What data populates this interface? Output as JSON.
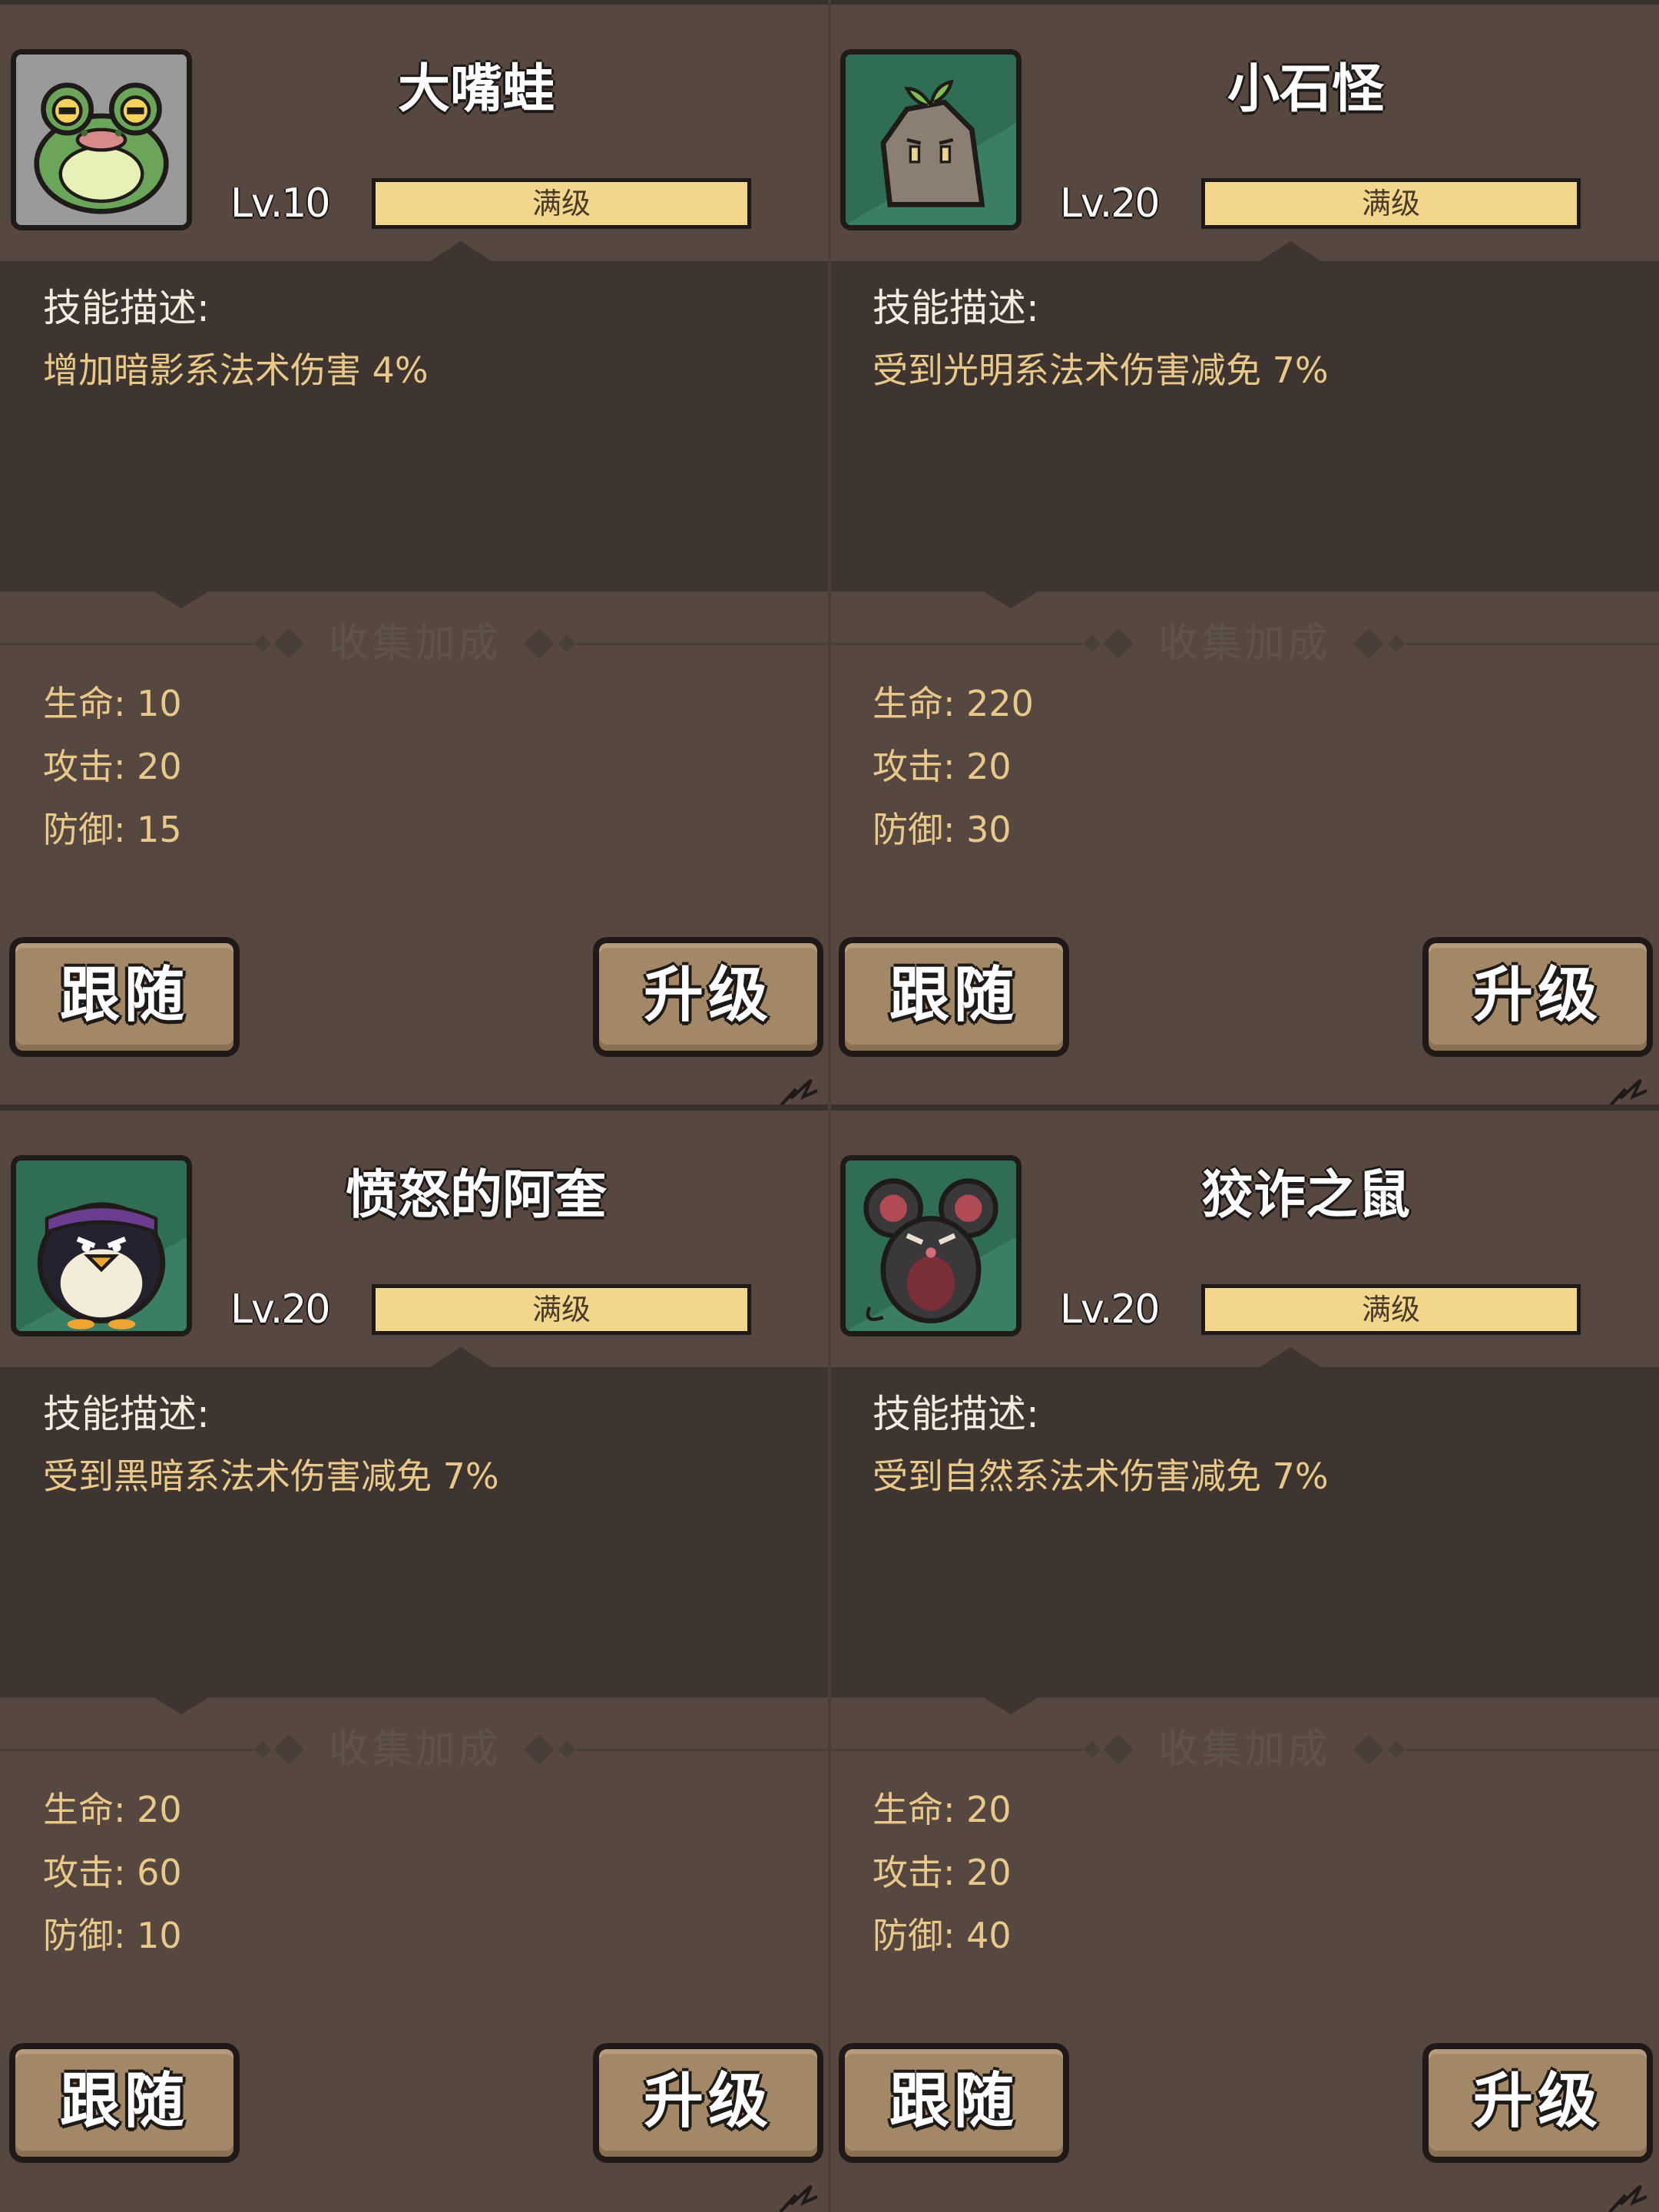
{
  "pets": [
    {
      "name": "大嘴蛙",
      "level": "Lv.10",
      "level_status": "满级",
      "level_progress": 1.0,
      "desc_label": "技能描述:",
      "desc_text": "增加暗影系法术伤害 4%",
      "bonus_title": "收集加成",
      "stats": [
        "生命: 10",
        "攻击: 20",
        "防御: 15"
      ],
      "follow_label": "跟随",
      "upgrade_label": "升级",
      "portrait_bg": "#9a9a9a",
      "portrait_icon": "frog-icon"
    },
    {
      "name": "小石怪",
      "level": "Lv.20",
      "level_status": "满级",
      "level_progress": 1.0,
      "desc_label": "技能描述:",
      "desc_text": "受到光明系法术伤害减免 7%",
      "bonus_title": "收集加成",
      "stats": [
        "生命: 220",
        "攻击: 20",
        "防御: 30"
      ],
      "follow_label": "跟随",
      "upgrade_label": "升级",
      "portrait_bg": "#2f6e55",
      "portrait_icon": "rock-sprout-icon"
    },
    {
      "name": "愤怒的阿奎",
      "level": "Lv.20",
      "level_status": "满级",
      "level_progress": 1.0,
      "desc_label": "技能描述:",
      "desc_text": "受到黑暗系法术伤害减免 7%",
      "bonus_title": "收集加成",
      "stats": [
        "生命: 20",
        "攻击: 60",
        "防御: 10"
      ],
      "follow_label": "跟随",
      "upgrade_label": "升级",
      "portrait_bg": "#2f6e55",
      "portrait_icon": "penguin-icon"
    },
    {
      "name": "狡诈之鼠",
      "level": "Lv.20",
      "level_status": "满级",
      "level_progress": 1.0,
      "desc_label": "技能描述:",
      "desc_text": "受到自然系法术伤害减免 7%",
      "bonus_title": "收集加成",
      "stats": [
        "生命: 20",
        "攻击: 20",
        "防御: 40"
      ],
      "follow_label": "跟随",
      "upgrade_label": "升级",
      "portrait_bg": "#2f6e55",
      "portrait_icon": "rat-icon"
    }
  ],
  "colors": {
    "card_bg": "#564841",
    "panel_bg": "#3f3530",
    "level_bar_fill": "#f1d68c",
    "stat_text": "#e8c98a",
    "button_bg": "#a28866"
  }
}
